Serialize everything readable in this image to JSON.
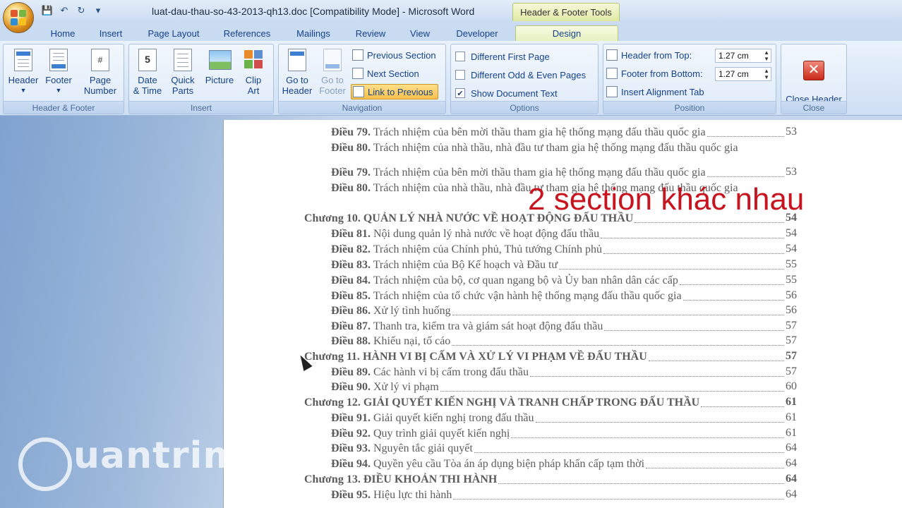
{
  "window": {
    "title": "luat-dau-thau-so-43-2013-qh13.doc [Compatibility Mode] - Microsoft Word",
    "contextual_tab_group": "Header & Footer Tools"
  },
  "quick_access": {
    "save_icon": "save-icon",
    "undo_icon": "undo-icon",
    "redo_icon": "redo-icon",
    "customize_icon": "customize-qat-icon"
  },
  "tabs": [
    "Home",
    "Insert",
    "Page Layout",
    "References",
    "Mailings",
    "Review",
    "View",
    "Developer",
    "Design"
  ],
  "active_tab": "Design",
  "ribbon": {
    "header_footer": {
      "label": "Header & Footer",
      "header": "Header",
      "footer": "Footer",
      "page_number": "Page\nNumber"
    },
    "insert": {
      "label": "Insert",
      "date_time": "Date\n& Time",
      "quick_parts": "Quick\nParts",
      "picture": "Picture",
      "clip_art": "Clip\nArt"
    },
    "navigation": {
      "label": "Navigation",
      "go_to_header": "Go to\nHeader",
      "go_to_footer": "Go to\nFooter",
      "previous_section": "Previous Section",
      "next_section": "Next Section",
      "link_to_previous": "Link to Previous"
    },
    "options": {
      "label": "Options",
      "different_first_page": "Different First Page",
      "different_first_page_checked": false,
      "different_odd_even": "Different Odd & Even Pages",
      "different_odd_even_checked": false,
      "show_document_text": "Show Document Text",
      "show_document_text_checked": true
    },
    "position": {
      "label": "Position",
      "header_from_top": "Header from Top:",
      "header_from_top_value": "1.27 cm",
      "footer_from_bottom": "Footer from Bottom:",
      "footer_from_bottom_value": "1.27 cm",
      "insert_alignment_tab": "Insert Alignment Tab"
    },
    "close": {
      "label": "Close",
      "close_header_footer": "Close Header\nand Footer"
    }
  },
  "document": {
    "toc": [
      {
        "kind": "art",
        "num": "Điều 79.",
        "text": "Trách nhiệm của bên mời thầu tham gia hệ thống mạng đấu thầu quốc gia",
        "page": "53"
      },
      {
        "kind": "art",
        "num": "Điều 80.",
        "text": "Trách nhiệm của nhà thầu, nhà đầu tư tham gia hệ thống mạng đấu thầu quốc gia",
        "page": ""
      },
      {
        "kind": "art",
        "num": "Điều 79.",
        "text": "Trách nhiệm của bên mời thầu tham gia hệ thống mạng đấu thầu quốc gia",
        "page": "53"
      },
      {
        "kind": "art",
        "num": "Điều 80.",
        "text": "Trách nhiệm của nhà thầu, nhà đầu tư tham gia hệ thống mạng đấu thầu quốc gia",
        "page": ""
      },
      {
        "kind": "chap",
        "num": "Chương 10.",
        "text": "QUẢN LÝ NHÀ NƯỚC VỀ HOẠT ĐỘNG ĐẤU THẦU",
        "page": "54"
      },
      {
        "kind": "art",
        "num": "Điều 81.",
        "text": "Nội dung quản lý nhà nước về hoạt động đấu thầu",
        "page": "54"
      },
      {
        "kind": "art",
        "num": "Điều 82.",
        "text": "Trách nhiệm của Chính phủ, Thủ tướng Chính phủ",
        "page": "54"
      },
      {
        "kind": "art",
        "num": "Điều 83.",
        "text": "Trách nhiệm của Bộ Kế hoạch và Đầu tư",
        "page": "55"
      },
      {
        "kind": "art",
        "num": "Điều 84.",
        "text": "Trách nhiệm của bộ, cơ quan ngang bộ và Ủy ban nhân dân các cấp",
        "page": "55"
      },
      {
        "kind": "art",
        "num": "Điều 85.",
        "text": "Trách nhiệm của tổ chức vận hành hệ thống mạng đấu thầu quốc gia",
        "page": "56"
      },
      {
        "kind": "art",
        "num": "Điều 86.",
        "text": "Xử lý tình huống",
        "page": "56"
      },
      {
        "kind": "art",
        "num": "Điều 87.",
        "text": "Thanh tra, kiểm tra và giám sát hoạt động đấu thầu",
        "page": "57"
      },
      {
        "kind": "art",
        "num": "Điều 88.",
        "text": "Khiếu nại, tố cáo",
        "page": "57"
      },
      {
        "kind": "chap",
        "num": "Chương 11.",
        "text": "HÀNH VI BỊ CẤM VÀ XỬ LÝ VI PHẠM VỀ ĐẤU THẦU",
        "page": "57"
      },
      {
        "kind": "art",
        "num": "Điều 89.",
        "text": "Các hành vi bị cấm trong đấu thầu",
        "page": "57"
      },
      {
        "kind": "art",
        "num": "Điều 90.",
        "text": "Xử lý vi phạm",
        "page": "60"
      },
      {
        "kind": "chap",
        "num": "Chương 12.",
        "text": "GIẢI QUYẾT KIẾN NGHỊ VÀ TRANH CHẤP TRONG ĐẤU THẦU",
        "page": "61"
      },
      {
        "kind": "art",
        "num": "Điều 91.",
        "text": "Giải quyết kiến nghị trong đấu thầu",
        "page": "61"
      },
      {
        "kind": "art",
        "num": "Điều 92.",
        "text": "Quy trình giải quyết kiến nghị",
        "page": "61"
      },
      {
        "kind": "art",
        "num": "Điều 93.",
        "text": "Nguyên tắc giải quyết",
        "page": "64"
      },
      {
        "kind": "art",
        "num": "Điều 94.",
        "text": "Quyền yêu cầu Tòa án áp dụng biện pháp khẩn cấp tạm thời",
        "page": "64"
      },
      {
        "kind": "chap",
        "num": "Chương 13.",
        "text": "ĐIỀU KHOẢN THI HÀNH",
        "page": "64"
      },
      {
        "kind": "art",
        "num": "Điều 95.",
        "text": "Hiệu lực thi hành",
        "page": "64"
      }
    ]
  },
  "annotation": "2 section khác nhau",
  "watermark": "uantrimang"
}
